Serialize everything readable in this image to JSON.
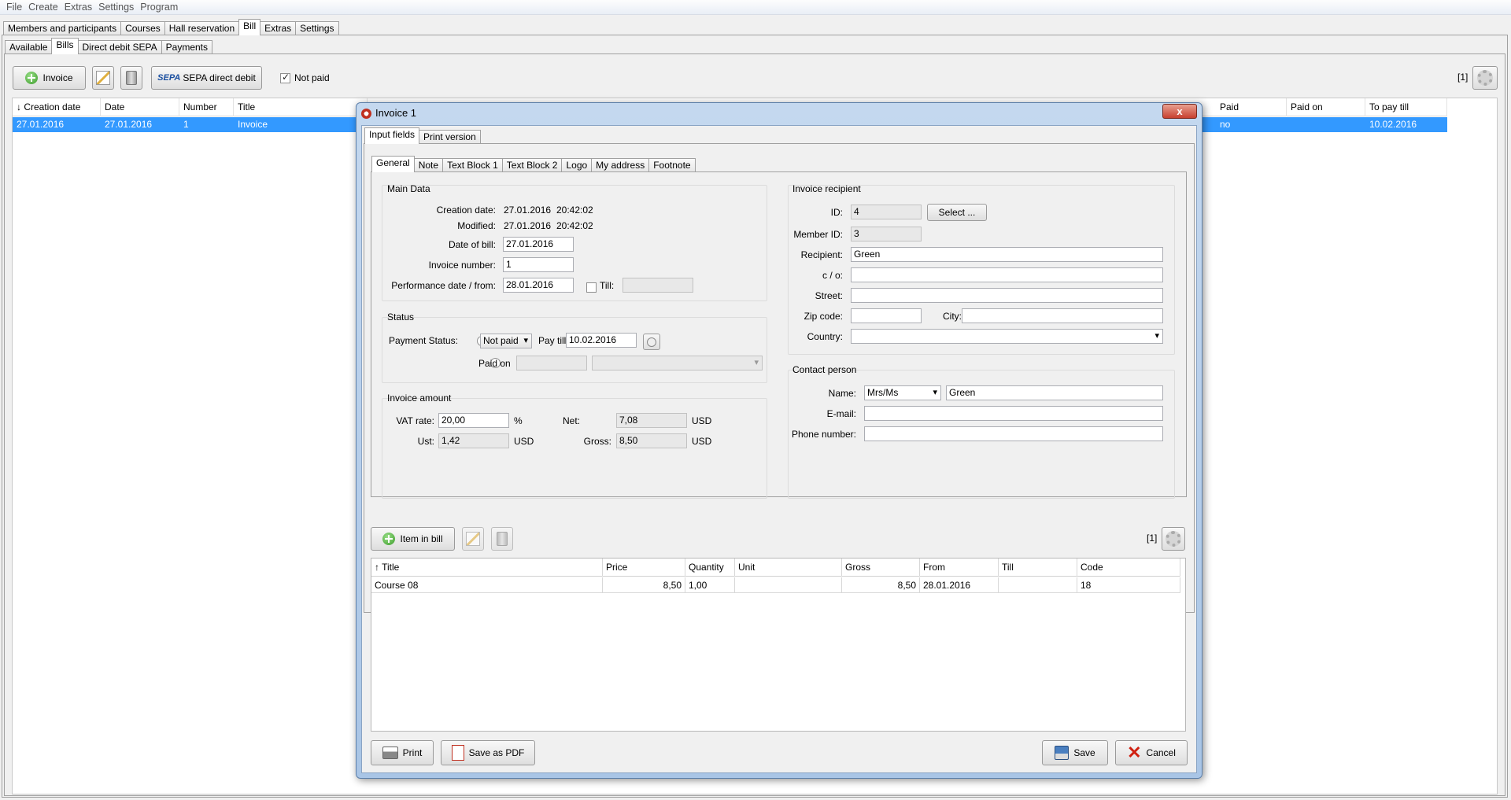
{
  "menu": [
    "File",
    "Create",
    "Extras",
    "Settings",
    "Program"
  ],
  "main_tabs": [
    "Members and participants",
    "Courses",
    "Hall reservation",
    "Bill",
    "Extras",
    "Settings"
  ],
  "sub_tabs": [
    "Available",
    "Bills",
    "Direct debit SEPA",
    "Payments"
  ],
  "toolbar": {
    "invoice_label": "Invoice",
    "sepa_prefix": "SEPA",
    "sepa_label": "SEPA direct debit",
    "not_paid_label": "Not paid",
    "count": "[1]"
  },
  "bills_table": {
    "columns": [
      "↓ Creation date",
      "Date",
      "Number",
      "Title",
      "Paid",
      "Paid on",
      "To pay till"
    ],
    "row": {
      "creation_date": "27.01.2016",
      "date": "27.01.2016",
      "number": "1",
      "title": "Invoice",
      "paid": "no",
      "paid_on": "",
      "to_pay_till": "10.02.2016"
    }
  },
  "dialog": {
    "title": "Invoice 1",
    "close": "x",
    "outer_tabs": [
      "Input fields",
      "Print version"
    ],
    "inner_tabs": [
      "General",
      "Note",
      "Text Block 1",
      "Text Block 2",
      "Logo",
      "My address",
      "Footnote"
    ],
    "main_data": {
      "title": "Main Data",
      "creation_date_label": "Creation date:",
      "creation_date": "27.01.2016",
      "creation_time": "20:42:02",
      "modified_label": "Modified:",
      "modified_date": "27.01.2016",
      "modified_time": "20:42:02",
      "date_of_bill_label": "Date of bill:",
      "date_of_bill": "27.01.2016",
      "invoice_number_label": "Invoice number:",
      "invoice_number": "1",
      "performance_label": "Performance date / from:",
      "performance_date": "28.01.2016",
      "till_label": "Till:",
      "till_value": ""
    },
    "status": {
      "title": "Status",
      "payment_status_label": "Payment Status:",
      "status_value": "Not paid",
      "pay_till_label": "Pay till",
      "pay_till": "10.02.2016",
      "paid_on_label": "Paid on"
    },
    "amount": {
      "title": "Invoice amount",
      "vat_label": "VAT rate:",
      "vat": "20,00",
      "percent": "%",
      "net_label": "Net:",
      "net": "7,08",
      "ust_label": "Ust:",
      "ust": "1,42",
      "gross_label": "Gross:",
      "gross": "8,50",
      "currency": "USD"
    },
    "recipient": {
      "title": "Invoice recipient",
      "id_label": "ID:",
      "id": "4",
      "select_label": "Select ...",
      "member_id_label": "Member ID:",
      "member_id": "3",
      "recipient_label": "Recipient:",
      "recipient": "Green",
      "co_label": "c / o:",
      "street_label": "Street:",
      "zip_label": "Zip code:",
      "city_label": "City:",
      "country_label": "Country:"
    },
    "contact": {
      "title": "Contact person",
      "name_label": "Name:",
      "salutation": "Mrs/Ms",
      "name": "Green",
      "email_label": "E-mail:",
      "phone_label": "Phone number:"
    },
    "items": {
      "add_label": "Item in bill",
      "count": "[1]",
      "columns": [
        "↑ Title",
        "Price",
        "Quantity",
        "Unit",
        "Gross",
        "From",
        "Till",
        "Code"
      ],
      "row": {
        "title": "Course 08",
        "price": "8,50",
        "quantity": "1,00",
        "unit": "",
        "gross": "8,50",
        "from": "28.01.2016",
        "till": "",
        "code": "18"
      }
    },
    "footer": {
      "print": "Print",
      "save_pdf": "Save as PDF",
      "save": "Save",
      "cancel": "Cancel"
    }
  },
  "colors": {
    "selection": "#3399ff",
    "dialog_frame": "#a9c5e6",
    "close_button": "#c84030"
  }
}
